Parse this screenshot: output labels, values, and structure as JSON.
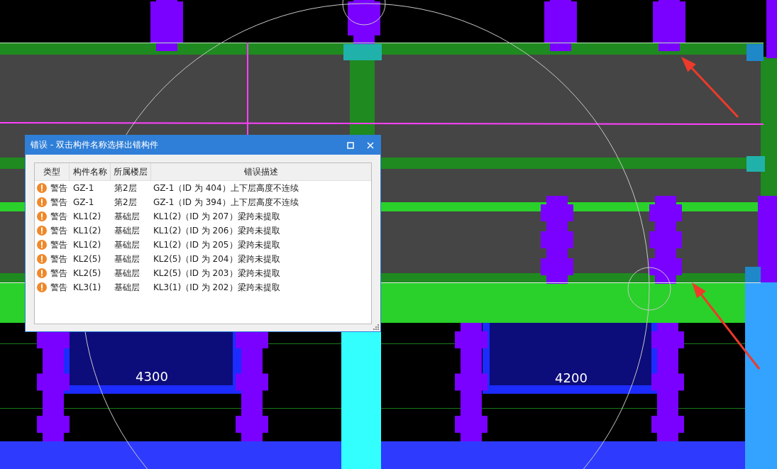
{
  "canvas": {
    "dimension_labels": [
      "4300",
      "4200"
    ]
  },
  "dialog": {
    "title": "错误 - 双击构件名称选择出错构件",
    "columns": [
      "类型",
      "构件名称",
      "所属楼层",
      "错误描述"
    ],
    "rows": [
      {
        "type": "警告",
        "name": "GZ-1",
        "floor": "第2层",
        "description": "GZ-1（ID 为 404）上下层高度不连续"
      },
      {
        "type": "警告",
        "name": "GZ-1",
        "floor": "第2层",
        "description": "GZ-1（ID 为 394）上下层高度不连续"
      },
      {
        "type": "警告",
        "name": "KL1(2)",
        "floor": "基础层",
        "description": "KL1(2)（ID 为 207）梁跨未提取"
      },
      {
        "type": "警告",
        "name": "KL1(2)",
        "floor": "基础层",
        "description": "KL1(2)（ID 为 206）梁跨未提取"
      },
      {
        "type": "警告",
        "name": "KL1(2)",
        "floor": "基础层",
        "description": "KL1(2)（ID 为 205）梁跨未提取"
      },
      {
        "type": "警告",
        "name": "KL2(5)",
        "floor": "基础层",
        "description": "KL2(5)（ID 为 204）梁跨未提取"
      },
      {
        "type": "警告",
        "name": "KL2(5)",
        "floor": "基础层",
        "description": "KL2(5)（ID 为 203）梁跨未提取"
      },
      {
        "type": "警告",
        "name": "KL3(1)",
        "floor": "基础层",
        "description": "KL3(1)（ID 为 202）梁跨未提取"
      }
    ]
  }
}
